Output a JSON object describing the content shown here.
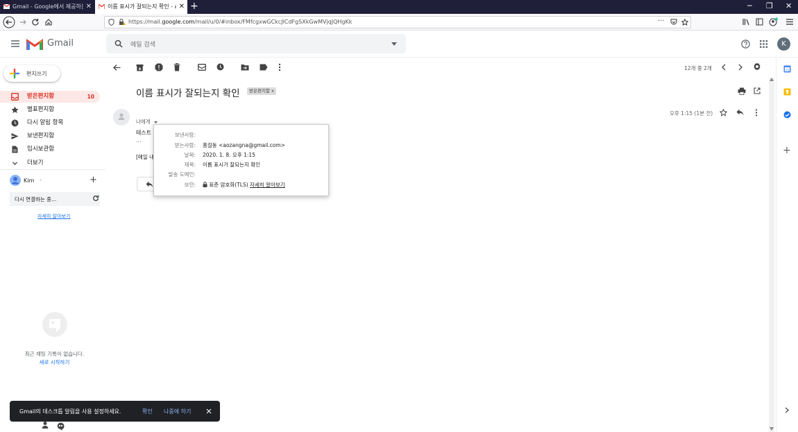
{
  "browser": {
    "tabs": [
      {
        "title": "Gmail - Google에서 제공하는",
        "close": "✕"
      },
      {
        "title": "이름 표시가 잘되는지 확인 - a",
        "close": "✕"
      }
    ],
    "url_prefix": "https://mail.",
    "url_host": "google.com",
    "url_path": "/mail/u/0/#inbox/FMfcgxwGCkcJlCdFgSXkGwMVjqJQHgKk",
    "page_menu": "···"
  },
  "header": {
    "app_name": "Gmail",
    "search_placeholder": "메일 검색",
    "avatar_letter": "K"
  },
  "sidebar": {
    "compose_label": "편지쓰기",
    "items": [
      {
        "label": "받은편지함",
        "count": "10"
      },
      {
        "label": "별표편지함"
      },
      {
        "label": "다시 알림 항목"
      },
      {
        "label": "보낸편지함"
      },
      {
        "label": "임시보관함"
      },
      {
        "label": "더보기"
      }
    ],
    "hangouts_user": "Kim",
    "hangouts_user_caret": "-",
    "reconnecting": "다시 연결하는 중...",
    "learn_more": "자세히 알아보기",
    "chat_empty": "최근 채팅 기록이 없습니다.",
    "chat_start": "새로 시작하기"
  },
  "toolbar": {
    "pager": "12개 중 2개"
  },
  "message": {
    "subject": "이름 표시가 잘되는지 확인",
    "label_chip": "받은편지함",
    "label_chip_close": "x",
    "to_me": "나에게",
    "time": "오후 1:15 (1분 전)",
    "body_line1": "테스트",
    "body_line2": "...",
    "body_line3": "[메일 내"
  },
  "details": {
    "from_label": "보낸사람:",
    "from_value": "",
    "to_label": "받는사람:",
    "to_value": "홍길동 <aozangna@gmail.com>",
    "date_label": "날짜:",
    "date_value": "2020. 1. 8. 오후 1:15",
    "subject_label": "제목:",
    "subject_value": "이름 표시가 잘되는지 확인",
    "mailed_by_label": "발송 도메인:",
    "security_label": "보안:",
    "security_value": "표준 암호화(TLS)",
    "security_link": "자세히 알아보기"
  },
  "snackbar": {
    "text": "Gmail의 데스크톱 알림을 사용 설정하세요.",
    "ok": "확인",
    "later": "나중에 하기"
  },
  "colors": {
    "accent_red": "#d93025",
    "link_blue": "#1a73e8",
    "tab_bar": "#1f1f3a"
  }
}
